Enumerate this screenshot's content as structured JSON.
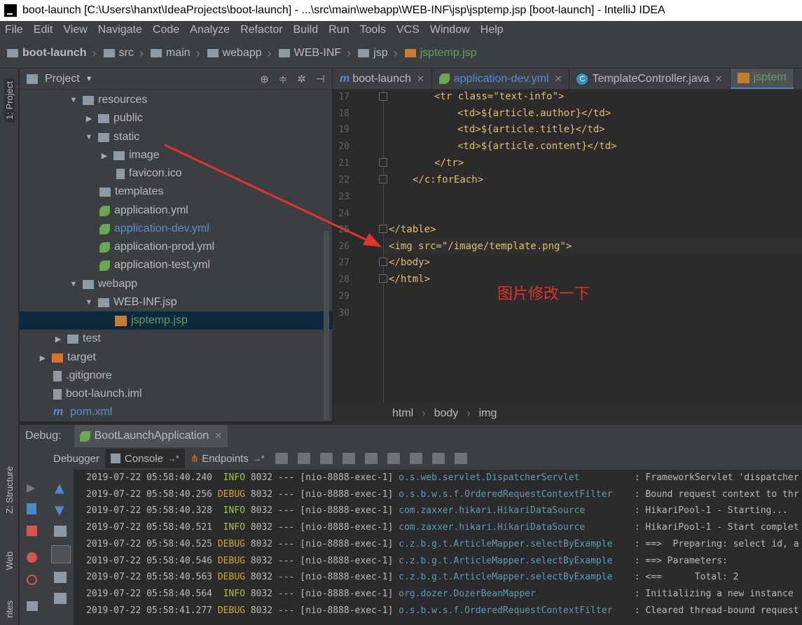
{
  "window": {
    "title": "boot-launch [C:\\Users\\hanxt\\IdeaProjects\\boot-launch] - ...\\src\\main\\webapp\\WEB-INF\\jsp\\jsptemp.jsp [boot-launch] - IntelliJ IDEA"
  },
  "menu": [
    "File",
    "Edit",
    "View",
    "Navigate",
    "Code",
    "Analyze",
    "Refactor",
    "Build",
    "Run",
    "Tools",
    "VCS",
    "Window",
    "Help"
  ],
  "nav": [
    "boot-launch",
    "src",
    "main",
    "webapp",
    "WEB-INF",
    "jsp",
    "jsptemp.jsp"
  ],
  "side": {
    "project_tab": "1: Project",
    "structure_tab": "Z: Structure",
    "web_tab": "Web",
    "favorites_tab": "rites"
  },
  "project": {
    "header": "Project",
    "tree": [
      {
        "label": "resources",
        "kind": "folder",
        "expanded": true
      },
      {
        "label": "public",
        "kind": "folder",
        "expanded": false
      },
      {
        "label": "static",
        "kind": "folder",
        "expanded": true
      },
      {
        "label": "image",
        "kind": "folder",
        "expanded": false
      },
      {
        "label": "favicon.ico",
        "kind": "file"
      },
      {
        "label": "templates",
        "kind": "folder"
      },
      {
        "label": "application.yml",
        "kind": "spring"
      },
      {
        "label": "application-dev.yml",
        "kind": "spring"
      },
      {
        "label": "application-prod.yml",
        "kind": "spring"
      },
      {
        "label": "application-test.yml",
        "kind": "spring"
      },
      {
        "label": "webapp",
        "kind": "folder",
        "expanded": true
      },
      {
        "label": "WEB-INF.jsp",
        "kind": "folder",
        "expanded": true
      },
      {
        "label": "jsptemp.jsp",
        "kind": "jsp"
      },
      {
        "label": "test",
        "kind": "folder",
        "expanded": false
      },
      {
        "label": "target",
        "kind": "folder",
        "expanded": false
      },
      {
        "label": ".gitignore",
        "kind": "file"
      },
      {
        "label": "boot-launch.iml",
        "kind": "file"
      },
      {
        "label": "pom.xml",
        "kind": "maven"
      }
    ]
  },
  "tabs": [
    {
      "label": "boot-launch",
      "icon": "maven-icon"
    },
    {
      "label": "application-dev.yml",
      "icon": "spring-icon"
    },
    {
      "label": "TemplateController.java",
      "icon": "class-icon"
    },
    {
      "label": "jsptem",
      "icon": "jsp-icon"
    }
  ],
  "editor": {
    "lines": [
      {
        "n": "17",
        "code": "<tr class=\"text-info\">"
      },
      {
        "n": "18",
        "code": "<td>${article.author}</td>"
      },
      {
        "n": "19",
        "code": "<td>${article.title}</td>"
      },
      {
        "n": "20",
        "code": "<td>${article.content}</td>"
      },
      {
        "n": "21",
        "code": "</tr>"
      },
      {
        "n": "22",
        "code": "</c:forEach>"
      },
      {
        "n": "23",
        "code": ""
      },
      {
        "n": "24",
        "code": ""
      },
      {
        "n": "25",
        "code": "</table>"
      },
      {
        "n": "26",
        "code": "<img src=\"/image/template.png\">"
      },
      {
        "n": "27",
        "code": "</body>"
      },
      {
        "n": "28",
        "code": "</html>"
      },
      {
        "n": "29",
        "code": ""
      },
      {
        "n": "30",
        "code": ""
      }
    ],
    "annotation": "图片修改一下",
    "breadcrumb": [
      "html",
      "body",
      "img"
    ]
  },
  "debug": {
    "label": "Debug:",
    "session": "BootLaunchApplication",
    "tabs": [
      "Debugger",
      "Console",
      "Endpoints"
    ],
    "log": [
      {
        "ts": "2019-07-22 05:58:40.240",
        "lvl": "INFO",
        "pid": "8032",
        "sep": "---",
        "thread": "[nio-8888-exec-1]",
        "logger": "o.s.web.servlet.DispatcherServlet",
        "msg": ": FrameworkServlet 'dispatcher"
      },
      {
        "ts": "2019-07-22 05:58:40.256",
        "lvl": "DEBUG",
        "pid": "8032",
        "sep": "---",
        "thread": "[nio-8888-exec-1]",
        "logger": "o.s.b.w.s.f.OrderedRequestContextFilter",
        "msg": ": Bound request context to thr"
      },
      {
        "ts": "2019-07-22 05:58:40.328",
        "lvl": "INFO",
        "pid": "8032",
        "sep": "---",
        "thread": "[nio-8888-exec-1]",
        "logger": "com.zaxxer.hikari.HikariDataSource",
        "msg": ": HikariPool-1 - Starting..."
      },
      {
        "ts": "2019-07-22 05:58:40.521",
        "lvl": "INFO",
        "pid": "8032",
        "sep": "---",
        "thread": "[nio-8888-exec-1]",
        "logger": "com.zaxxer.hikari.HikariDataSource",
        "msg": ": HikariPool-1 - Start complet"
      },
      {
        "ts": "2019-07-22 05:58:40.525",
        "lvl": "DEBUG",
        "pid": "8032",
        "sep": "---",
        "thread": "[nio-8888-exec-1]",
        "logger": "c.z.b.g.t.ArticleMapper.selectByExample",
        "msg": ": ==>  Preparing: select id, a"
      },
      {
        "ts": "2019-07-22 05:58:40.546",
        "lvl": "DEBUG",
        "pid": "8032",
        "sep": "---",
        "thread": "[nio-8888-exec-1]",
        "logger": "c.z.b.g.t.ArticleMapper.selectByExample",
        "msg": ": ==> Parameters:"
      },
      {
        "ts": "2019-07-22 05:58:40.563",
        "lvl": "DEBUG",
        "pid": "8032",
        "sep": "---",
        "thread": "[nio-8888-exec-1]",
        "logger": "c.z.b.g.t.ArticleMapper.selectByExample",
        "msg": ": <==      Total: 2"
      },
      {
        "ts": "2019-07-22 05:58:40.564",
        "lvl": "INFO",
        "pid": "8032",
        "sep": "---",
        "thread": "[nio-8888-exec-1]",
        "logger": "org.dozer.DozerBeanMapper",
        "msg": ": Initializing a new instance"
      },
      {
        "ts": "2019-07-22 05:58:41.277",
        "lvl": "DEBUG",
        "pid": "8032",
        "sep": "---",
        "thread": "[nio-8888-exec-1]",
        "logger": "o.s.b.w.s.f.OrderedRequestContextFilter",
        "msg": ": Cleared thread-bound request"
      }
    ]
  },
  "colors": {
    "annotation": "#e0352b",
    "selection": "#0d293e",
    "spring": "#6aa84f",
    "link": "#5a8bd6"
  }
}
